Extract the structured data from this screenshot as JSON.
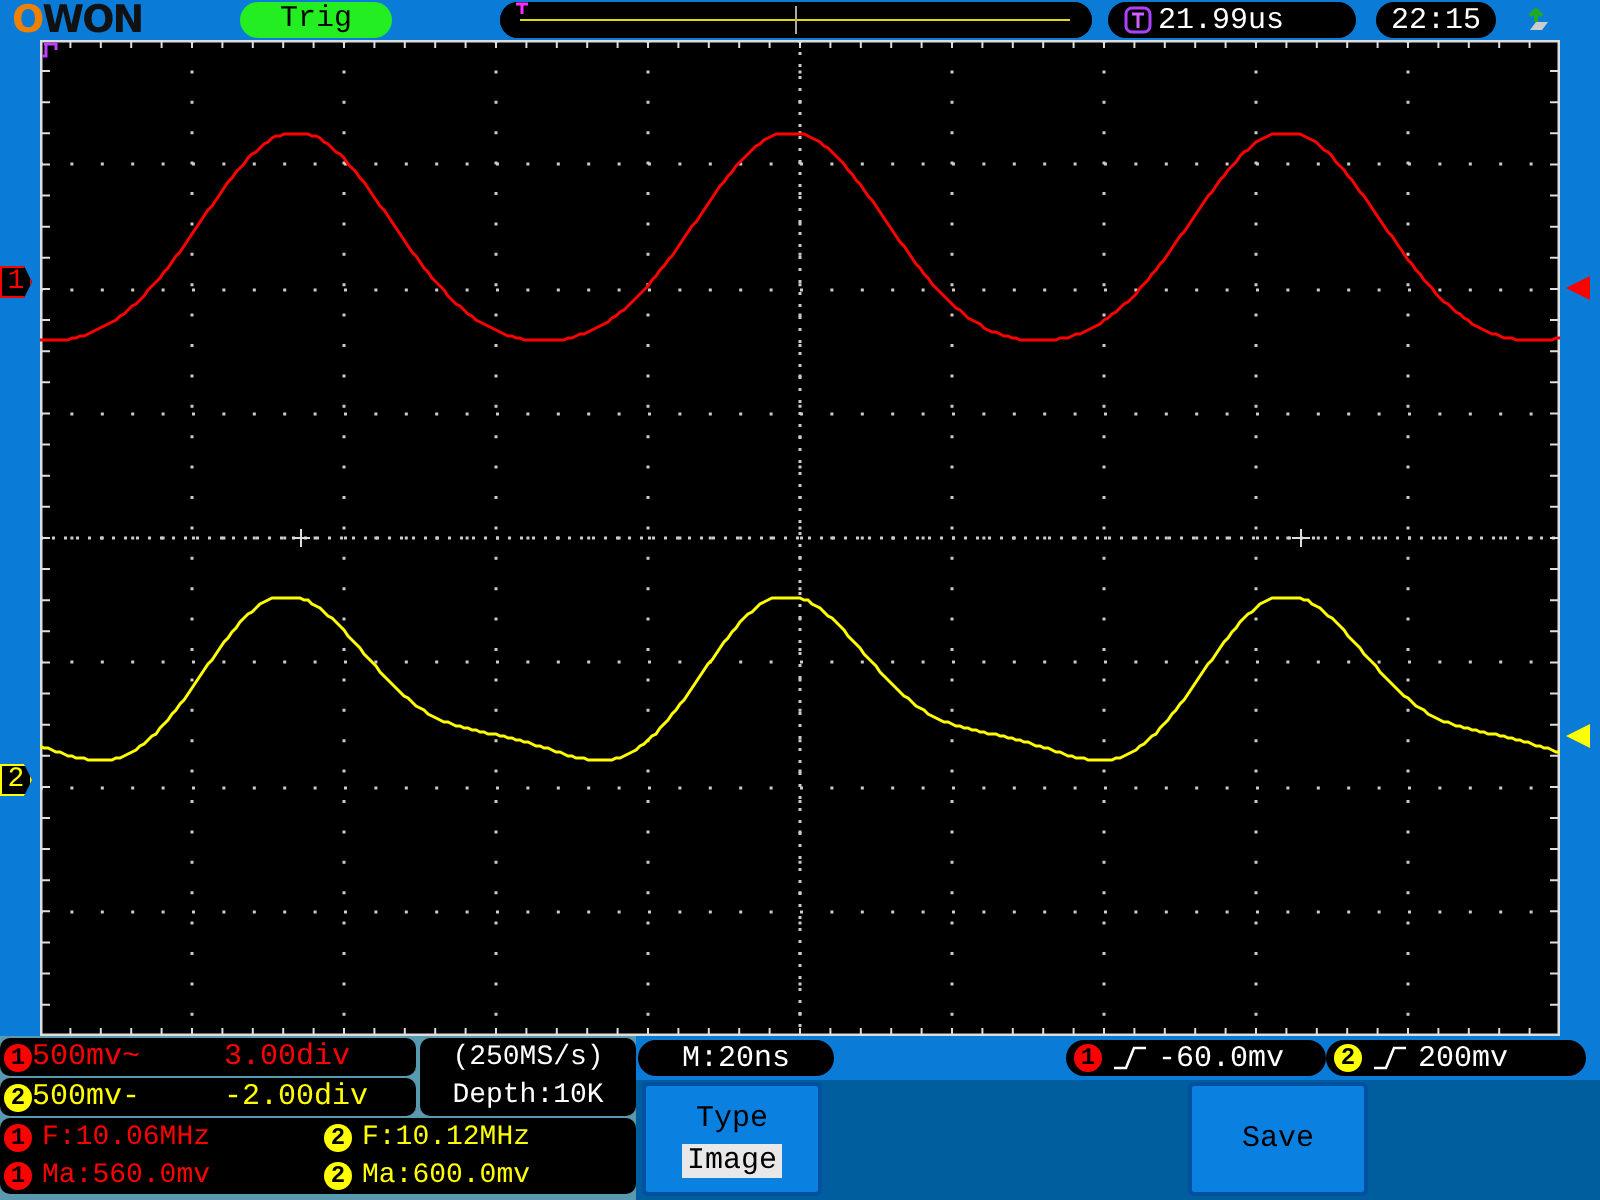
{
  "header": {
    "logo": "OWON",
    "status": "Trig",
    "trigger_time": "21.99us",
    "clock": "22:15"
  },
  "channels": [
    {
      "number": "1",
      "badges": {
        "scale": "1",
        "frequency": "1",
        "amplitude": "1",
        "trigger": "1"
      },
      "color": "#ff0000",
      "scale": "500mv~",
      "position": "3.00div",
      "frequency": "F:10.06MHz",
      "amplitude": "Ma:560.0mv",
      "trigger_level": "-60.0mv"
    },
    {
      "number": "2",
      "badges": {
        "scale": "2",
        "frequency": "2",
        "amplitude": "2",
        "trigger": "2"
      },
      "color": "#ffff00",
      "scale": "500mv-",
      "position": "-2.00div",
      "frequency": "F:10.12MHz",
      "amplitude": "Ma:600.0mv",
      "trigger_level": "200mv"
    }
  ],
  "acquisition": {
    "sample_rate": "(250MS/s)",
    "depth": "Depth:10K"
  },
  "timebase": "M:20ns",
  "menu": [
    {
      "kind": "option",
      "label": "Type",
      "value": "Image"
    },
    {
      "kind": "action",
      "label": "Save"
    }
  ]
}
